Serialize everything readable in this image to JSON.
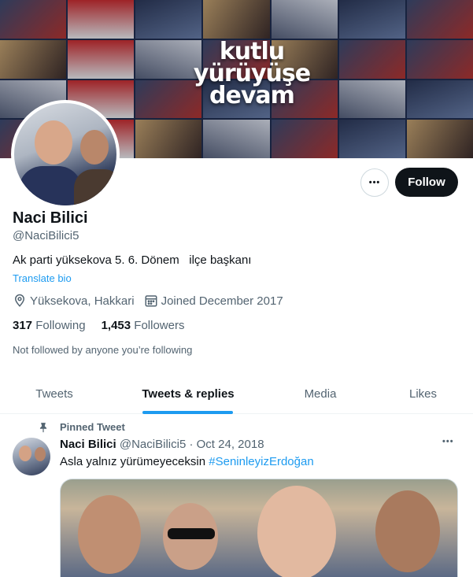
{
  "banner": {
    "line1": "kutlu",
    "line2": "yürüyüşe",
    "line3": "devam"
  },
  "profile": {
    "name": "Naci Bilici",
    "handle": "@NaciBilici5",
    "bio": "Ak parti yüksekova 5. 6. Dönem   ilçe başkanı",
    "translate_label": "Translate bio",
    "location": "Yüksekova, Hakkari",
    "joined": "Joined December 2017",
    "following_count": "317",
    "following_label": "Following",
    "followers_count": "1,453",
    "followers_label": "Followers",
    "not_followed": "Not followed by anyone you’re following"
  },
  "actions": {
    "more_label": "•••",
    "follow_label": "Follow"
  },
  "tabs": [
    {
      "label": "Tweets",
      "active": false
    },
    {
      "label": "Tweets & replies",
      "active": true
    },
    {
      "label": "Media",
      "active": false
    },
    {
      "label": "Likes",
      "active": false
    }
  ],
  "tweet": {
    "pinned_label": "Pinned Tweet",
    "author_name": "Naci Bilici",
    "author_handle": "@NaciBilici5",
    "separator": " · ",
    "date": "Oct 24, 2018",
    "more_label": "•••",
    "text": "Asla yalnız yürümeyeceksin ",
    "hashtag": "#SeninleyizErdoğan"
  },
  "colors": {
    "accent": "#1d9bf0",
    "text_primary": "#0f1419",
    "text_secondary": "#536471",
    "follow_button": "#0f1419"
  },
  "icons": {
    "location": "location-pin-icon",
    "calendar": "calendar-icon",
    "pin": "pin-icon",
    "more": "more-horizontal-icon"
  }
}
